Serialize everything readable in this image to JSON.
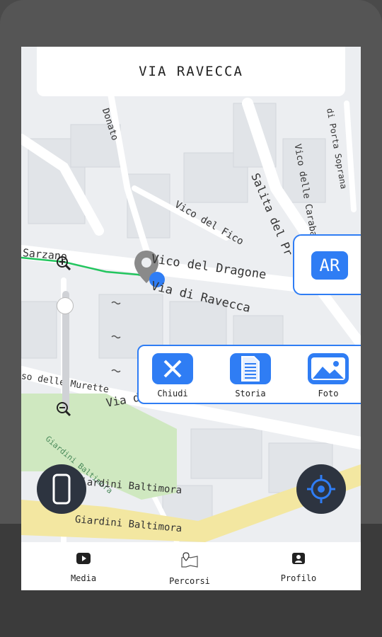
{
  "header": {
    "title": "VIA RAVECCA"
  },
  "map": {
    "streets": [
      "Donato",
      "Vico del Fico",
      "Vico del Dragone",
      "Via di Ravecca",
      "Salita del Pr",
      "Vico delle Carabag",
      "di Porta Soprana",
      "Sarzano",
      "so delle Murette",
      "Via del Colle",
      "Giardini Baltimora",
      "Giardini Baltimora",
      "Giardini Baltimora"
    ]
  },
  "ar_button": {
    "label": "AR"
  },
  "actions": [
    {
      "label": "Chiudi",
      "icon": "close-icon"
    },
    {
      "label": "Storia",
      "icon": "document-icon"
    },
    {
      "label": "Foto",
      "icon": "image-icon"
    }
  ],
  "bottom_nav": [
    {
      "label": "Media",
      "icon": "play-icon"
    },
    {
      "label": "Percorsi",
      "icon": "map-pin-icon"
    },
    {
      "label": "Profilo",
      "icon": "profile-icon"
    }
  ],
  "colors": {
    "accent": "#2f7df4",
    "route": "#22c55e",
    "fab": "#2d3440"
  }
}
